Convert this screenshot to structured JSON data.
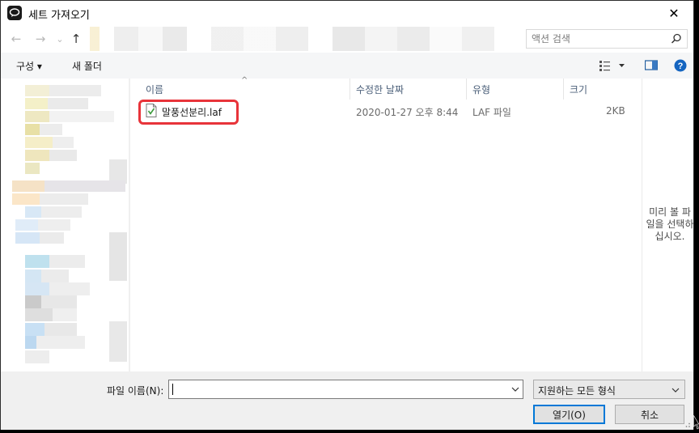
{
  "window": {
    "title": "세트 가져오기",
    "close_glyph": "✕",
    "app_icon": "app-icon"
  },
  "navigation": {
    "back_glyph": "←",
    "forward_glyph": "→",
    "recent_glyph": "⌄",
    "up_glyph": "↑",
    "search_placeholder": "액션 검색"
  },
  "toolbar": {
    "organize_label": "구성 ▾",
    "new_folder_label": "새 폴더"
  },
  "file_list": {
    "columns": [
      "이름",
      "수정한 날짜",
      "유형",
      "크기"
    ],
    "rows": [
      {
        "name": "말풍선분리.laf",
        "modified": "2020-01-27 오후 8:44",
        "type": "LAF 파일",
        "size": "2KB"
      }
    ]
  },
  "preview": {
    "text": "미리 볼 파일을 선택하십시오."
  },
  "footer": {
    "file_name_label": "파일 이름(N):",
    "file_name_value": "",
    "file_type_selected": "지원하는 모든 형식",
    "open_label": "열기(O)",
    "cancel_label": "취소"
  },
  "colors": {
    "highlight": "#e8343a",
    "help_icon": "#1565c0",
    "column_header_text": "#4c607a",
    "button_focus": "#0078d7"
  }
}
